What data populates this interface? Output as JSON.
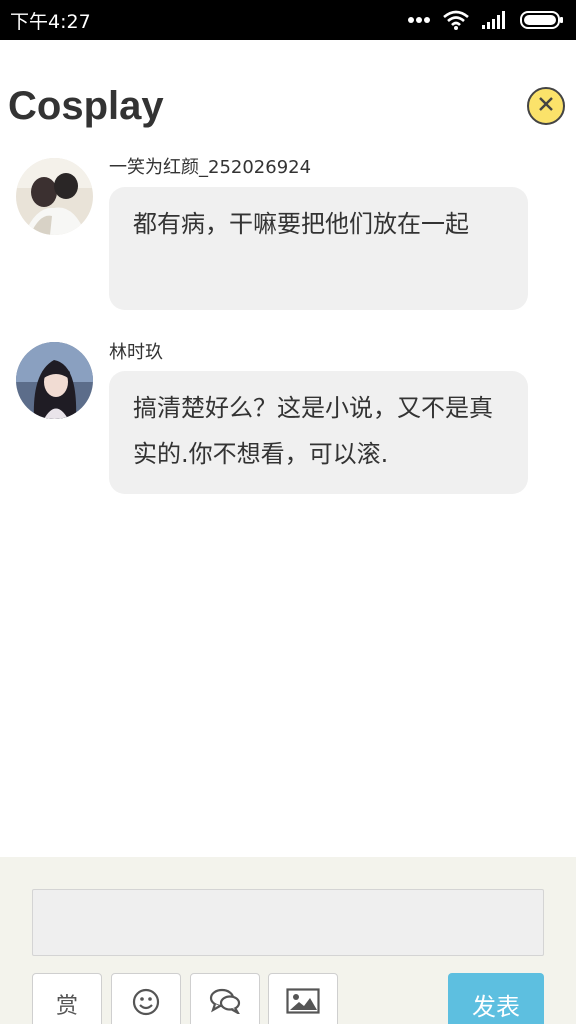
{
  "status_bar": {
    "time": "下午4:27",
    "icons": [
      "more-dots-icon",
      "wifi-icon",
      "signal-icon",
      "battery-icon"
    ]
  },
  "header": {
    "title": "Cosplay",
    "close_icon": "close-icon",
    "accent_color": "#fbe26a"
  },
  "messages": [
    {
      "author": "一笑为红颜_252026924",
      "text": "都有病，干嘛要把他们放在一起"
    },
    {
      "author": "林时玖",
      "text": "搞清楚好么？这是小说，又不是真实的.你不想看，可以滚."
    }
  ],
  "footer": {
    "input_placeholder": "",
    "reward_label": "赏",
    "tools": [
      "reward-icon",
      "emoji-icon",
      "chat-icon",
      "image-icon"
    ],
    "send_label": "发表",
    "send_color": "#5dbfe0"
  }
}
